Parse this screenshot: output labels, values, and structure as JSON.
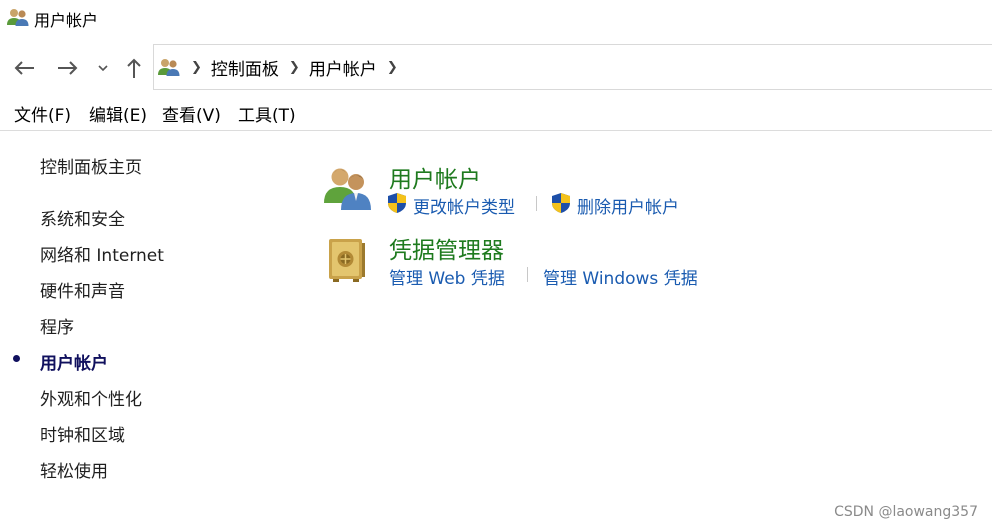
{
  "window": {
    "title": "用户帐户"
  },
  "address_bar": {
    "crumbs": [
      "控制面板",
      "用户帐户"
    ]
  },
  "menu": {
    "items": [
      "文件(F)",
      "编辑(E)",
      "查看(V)",
      "工具(T)"
    ]
  },
  "sidebar": {
    "home": "控制面板主页",
    "items": [
      "系统和安全",
      "网络和 Internet",
      "硬件和声音",
      "程序",
      "用户帐户",
      "外观和个性化",
      "时钟和区域",
      "轻松使用"
    ],
    "active": "用户帐户"
  },
  "sections": [
    {
      "title": "用户帐户",
      "icon": "users-icon",
      "links": [
        "更改帐户类型",
        "删除用户帐户"
      ]
    },
    {
      "title": "凭据管理器",
      "icon": "vault-icon",
      "links": [
        "管理 Web 凭据",
        "管理 Windows 凭据"
      ]
    }
  ],
  "watermark": "CSDN @laowang357",
  "colors": {
    "section_title": "#1e7a1e",
    "link": "#1a5bb0",
    "active_nav": "#10105e"
  }
}
